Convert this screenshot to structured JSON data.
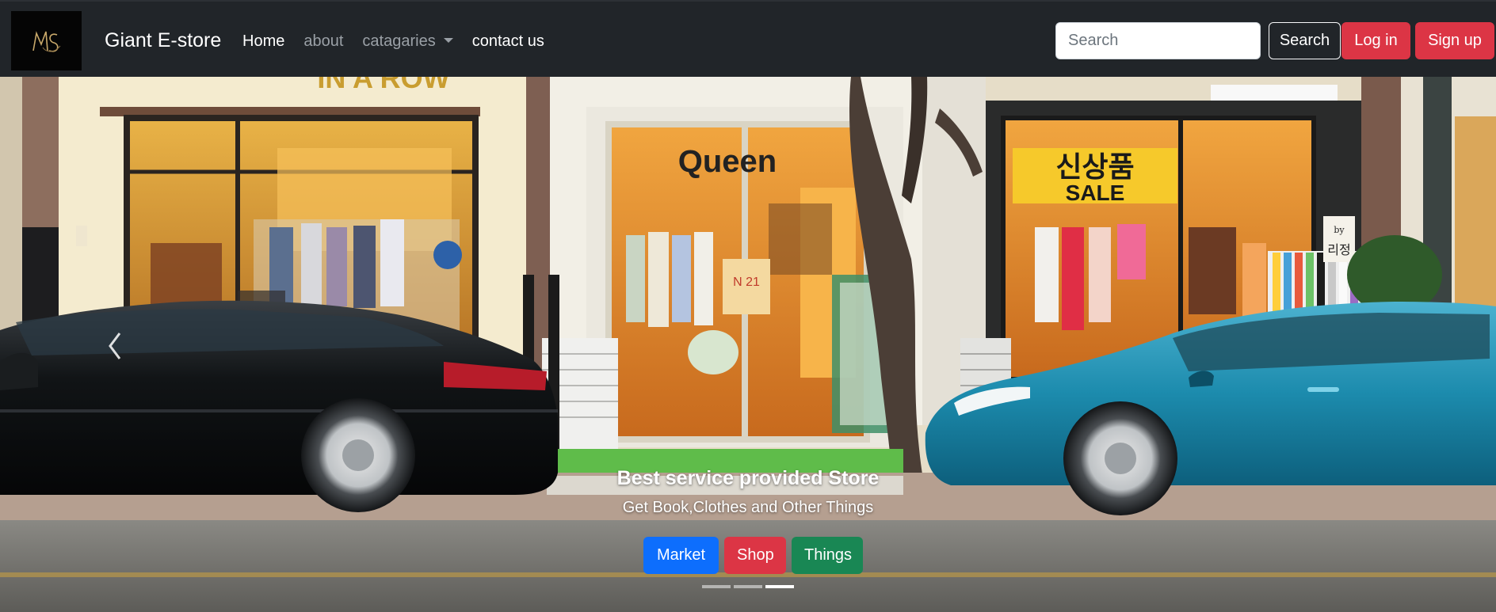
{
  "navbar": {
    "logo_icon": "ms-monogram-logo",
    "brand": "Giant E-store",
    "links": [
      {
        "label": "Home"
      },
      {
        "label": "about"
      },
      {
        "label": "catagaries"
      },
      {
        "label": "contact us"
      }
    ],
    "search": {
      "placeholder": "Search",
      "value": ""
    },
    "search_button": "Search",
    "login_button": "Log in",
    "signup_button": "Sign up"
  },
  "carousel": {
    "caption_title": "Best service provided Store",
    "caption_text": "Get Book,Clothes and Other Things",
    "buttons": [
      {
        "label": "Market",
        "color": "#0d6efd"
      },
      {
        "label": "Shop",
        "color": "#dc3545"
      },
      {
        "label": "Things",
        "color": "#198754"
      }
    ],
    "slide_count": 3,
    "active_slide": 3,
    "scene": {
      "left_store_sign": "IN A ROW",
      "middle_store_sign": "Queen",
      "right_store_sign_korean": "신상품",
      "right_store_sign_sale": "SALE",
      "small_sign_by": "by",
      "small_sign_name": "리정",
      "shirt_print": "N 21"
    }
  },
  "colors": {
    "navbar_bg": "#212529",
    "danger": "#dc3545",
    "primary": "#0d6efd",
    "success": "#198754"
  }
}
